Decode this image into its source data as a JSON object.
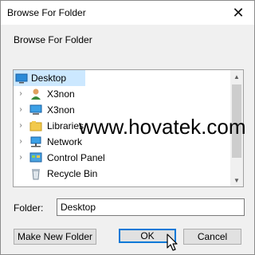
{
  "window": {
    "title": "Browse For Folder",
    "close_glyph": "✕"
  },
  "instruction": "Browse For Folder",
  "tree": {
    "items": [
      {
        "label": "Desktop",
        "icon": "desktop-icon",
        "expander": "",
        "selected": true
      },
      {
        "label": "X3non",
        "icon": "user-icon",
        "expander": "›",
        "selected": false
      },
      {
        "label": "X3non",
        "icon": "computer-icon",
        "expander": "›",
        "selected": false
      },
      {
        "label": "Libraries",
        "icon": "libraries-icon",
        "expander": "›",
        "selected": false
      },
      {
        "label": "Network",
        "icon": "network-icon",
        "expander": "›",
        "selected": false
      },
      {
        "label": "Control Panel",
        "icon": "control-panel-icon",
        "expander": "›",
        "selected": false
      },
      {
        "label": "Recycle Bin",
        "icon": "recycle-bin-icon",
        "expander": "",
        "selected": false
      }
    ]
  },
  "watermark": "www.hovatek.com",
  "folder": {
    "label": "Folder:",
    "value": "Desktop"
  },
  "buttons": {
    "make_new_folder": "Make New Folder",
    "ok": "OK",
    "cancel": "Cancel"
  },
  "colors": {
    "selection": "#cce8ff",
    "default_button_border": "#0078d7",
    "dialog_bg": "#f0f0f0"
  }
}
